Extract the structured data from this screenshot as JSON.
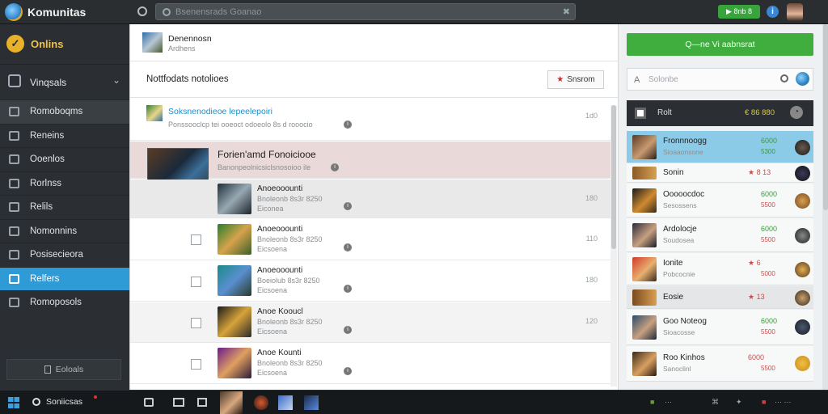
{
  "app": {
    "title": "Komunitas"
  },
  "search": {
    "placeholder": "Bsenensrads Goanao",
    "clear": "✖"
  },
  "topbar": {
    "green_label": "▶ 8nb 8"
  },
  "sidebar": {
    "online_label": "Onlins",
    "groups_label": "Vinqsals",
    "items": [
      {
        "label": "Romoboqms"
      },
      {
        "label": "Reneins"
      },
      {
        "label": "Ooenlos"
      },
      {
        "label": "Rorlnss"
      },
      {
        "label": "Relils"
      },
      {
        "label": "Nomonnins"
      },
      {
        "label": "Posisecieora"
      },
      {
        "label": "Relfers"
      },
      {
        "label": "Romoposols"
      }
    ],
    "bottom_button": "Eoloals"
  },
  "main": {
    "header": {
      "title": "Denennosn",
      "subtitle": "Ardhens"
    },
    "notif_title": "Nottfodats notolioes",
    "notif_button": "Snsrom",
    "rows": [
      {
        "title": "Soksnenodieoe lepeelepoiri",
        "sub": "Ponssooclcp tei ooeoct odoeolo 8s d rooocio",
        "time": "1d0"
      },
      {
        "title": "Forien'amd Fonoiciooe",
        "sub": "Banonpeolnicsiclsnosoioo ile",
        "time": ""
      },
      {
        "title": "Anoeooounti",
        "sub": "Bnoleonb 8s3r 8250",
        "sub2": "Eiconea",
        "time": "180"
      },
      {
        "title": "Anoeooounti",
        "sub": "Bnoleonb 8s3r 8250",
        "sub2": "Eicsoena",
        "time": "110"
      },
      {
        "title": "Anoeooounti",
        "sub": "Boeiolub 8s3r 8250",
        "sub2": "Eicsoena",
        "time": "180"
      },
      {
        "title": "Anoe Kooucl",
        "sub": "Bnoleonb 8s3r 8250",
        "sub2": "Eicsoena",
        "time": "120"
      },
      {
        "title": "Anoe Kounti",
        "sub": "Bnoleonb 8s3r 8250",
        "sub2": "Eicsoena",
        "time": ""
      }
    ]
  },
  "right": {
    "button": "Q—ne Vi aabnsrat",
    "search_placeholder": "Solonbe",
    "list_label": "Rolt",
    "list_count": "€ 86 880",
    "players": [
      {
        "name": "Fronnnoogg",
        "sub": "Sioaaonsone",
        "val": "6000",
        "sub2": "5300"
      },
      {
        "name": "Sonin",
        "sub": "",
        "val": "★ 8 13",
        "sub2": ""
      },
      {
        "name": "Ooooocdoc",
        "sub": "Sesossens",
        "val": "6000",
        "sub2": "5500"
      },
      {
        "name": "Ardolocje",
        "sub": "Soudosea",
        "val": "6000",
        "sub2": "5500"
      },
      {
        "name": "Ionite",
        "sub": "Pobcocnie",
        "val": "★ 6",
        "sub2": "5000"
      },
      {
        "name": "Eosie",
        "sub": "",
        "val": "★ 13",
        "sub2": ""
      },
      {
        "name": "Goo Noteog",
        "sub": "Sioacosse",
        "val": "6000",
        "sub2": "5500"
      },
      {
        "name": "Roo Kinhos",
        "sub": "Sanoclinl",
        "val": "6000",
        "sub2": "5500"
      }
    ]
  },
  "taskbar": {
    "search_label": "Soniicsas"
  },
  "colors": {
    "accent": "#2e9ad6",
    "green": "#3fae3f",
    "sidebar": "#2b2f33"
  }
}
